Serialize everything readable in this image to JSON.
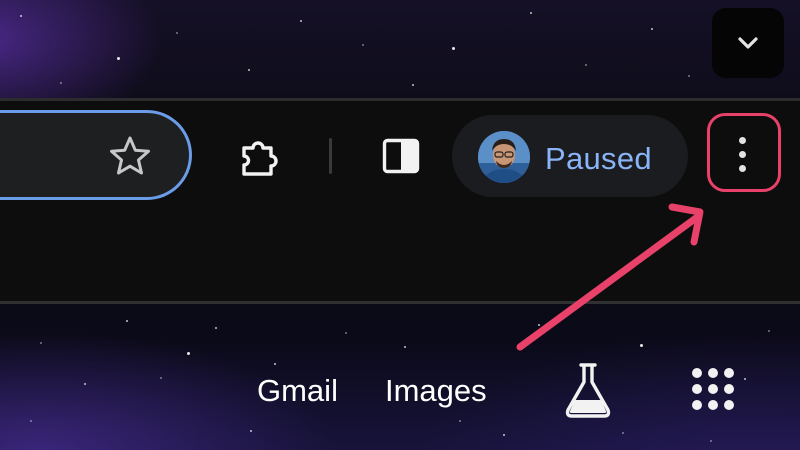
{
  "browser": {
    "toolbar": {
      "bookmark_icon": "star-outline-icon",
      "extensions_icon": "puzzle-piece-icon",
      "side_panel_icon": "side-panel-icon",
      "profile": {
        "status_label": "Paused",
        "avatar_icon": "profile-avatar"
      },
      "menu_icon": "three-dots-vertical-icon",
      "tab_search_icon": "chevron-down-icon"
    },
    "annotation": {
      "highlight_color": "#e8426a",
      "description_target": "menu-button"
    }
  },
  "new_tab_page": {
    "links": [
      {
        "label": "Gmail"
      },
      {
        "label": "Images"
      }
    ],
    "labs_icon": "flask-icon",
    "apps_icon": "apps-grid-icon"
  },
  "colors": {
    "accent_blue": "#8ab4f8",
    "omnibox_border": "#6b9ce8",
    "annotation_pink": "#e8426a",
    "toolbar_bg": "#0d0d0d"
  }
}
